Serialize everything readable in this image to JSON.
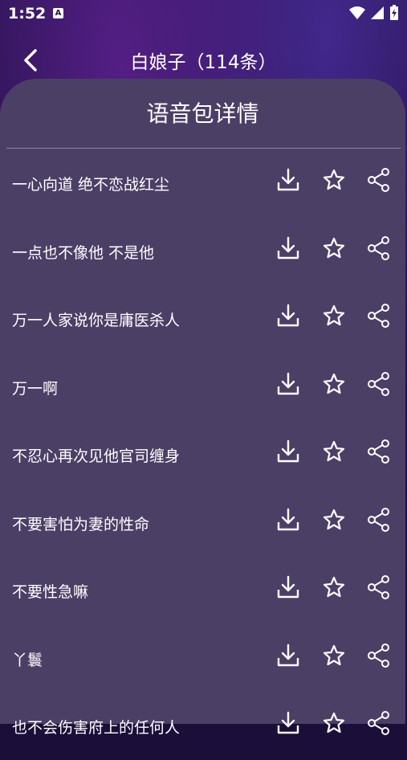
{
  "status_bar": {
    "time": "1:52",
    "notification_icon": "A"
  },
  "header": {
    "title": "白娘子（114条）"
  },
  "panel": {
    "title": "语音包详情"
  },
  "items": [
    {
      "label": "一心向道 绝不恋战红尘"
    },
    {
      "label": "一点也不像他 不是他"
    },
    {
      "label": "万一人家说你是庸医杀人"
    },
    {
      "label": "万一啊"
    },
    {
      "label": "不忍心再次见他官司缠身"
    },
    {
      "label": "不要害怕为妻的性命"
    },
    {
      "label": "不要性急嘛"
    },
    {
      "label": "丫鬟"
    },
    {
      "label": "也不会伤害府上的任何人"
    }
  ],
  "icons": {
    "download": "download-icon",
    "favorite": "star-icon",
    "share": "share-icon"
  }
}
